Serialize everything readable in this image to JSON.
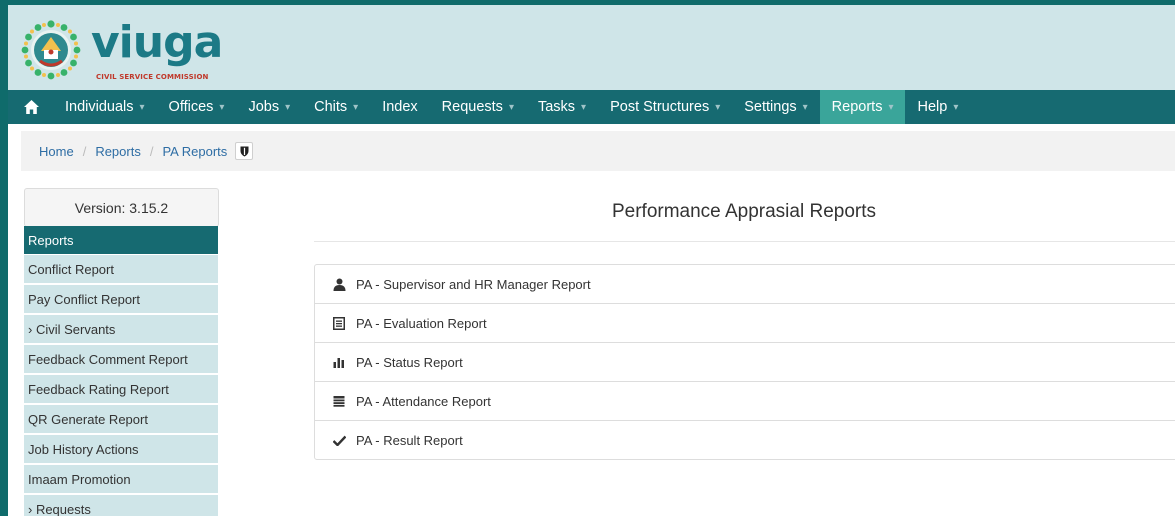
{
  "brand": {
    "name": "viuga",
    "subtitle": "CIVIL SERVICE COMMISSION"
  },
  "nav": {
    "items": [
      {
        "label": "Individuals",
        "caret": "▾"
      },
      {
        "label": "Offices",
        "caret": "▾"
      },
      {
        "label": "Jobs",
        "caret": "▾"
      },
      {
        "label": "Chits",
        "caret": "▾"
      },
      {
        "label": "Index",
        "caret": ""
      },
      {
        "label": "Requests",
        "caret": "▾"
      },
      {
        "label": "Tasks",
        "caret": "▾"
      },
      {
        "label": "Post Structures",
        "caret": "▾"
      },
      {
        "label": "Settings",
        "caret": "▾"
      },
      {
        "label": "Reports",
        "caret": "▾"
      },
      {
        "label": "Help",
        "caret": "▾"
      }
    ],
    "active": "Reports"
  },
  "breadcrumb": {
    "home": "Home",
    "reports": "Reports",
    "current": "PA Reports"
  },
  "sidebar": {
    "version": "Version: 3.15.2",
    "heading": "Reports",
    "items": [
      "Conflict Report",
      "Pay Conflict Report",
      "› Civil Servants",
      "Feedback Comment Report",
      "Feedback Rating Report",
      "QR Generate Report",
      "Job History Actions",
      "Imaam Promotion",
      "› Requests"
    ]
  },
  "main": {
    "title": "Performance Apprasial Reports",
    "reports": [
      {
        "label": "PA - Supervisor and HR Manager Report",
        "icon": "user-icon"
      },
      {
        "label": "PA - Evaluation Report",
        "icon": "list-alt-icon"
      },
      {
        "label": "PA - Status Report",
        "icon": "stats-icon"
      },
      {
        "label": "PA - Attendance Report",
        "icon": "calendar-icon"
      },
      {
        "label": "PA - Result Report",
        "icon": "checkmark-icon"
      }
    ]
  },
  "colors": {
    "frame": "#0f6b6b",
    "navbar": "#166a71",
    "nav_active": "#3aa59a",
    "brand_bg": "#cfe5e8",
    "sidebar_item": "#cfe5e8",
    "link": "#2e6da4"
  }
}
